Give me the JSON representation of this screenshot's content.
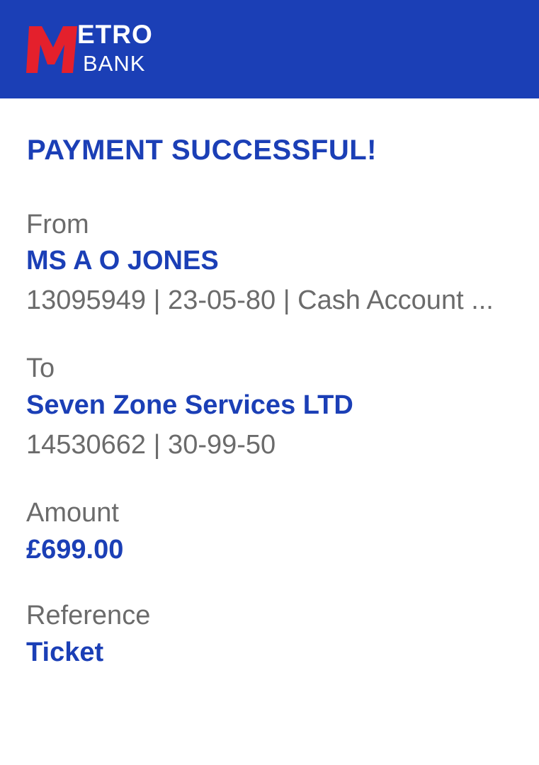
{
  "header": {
    "brand_line1": "ETRO",
    "brand_line2": "BANK",
    "brand_color": "#1b3fb6",
    "logo_accent_color": "#e4202c"
  },
  "confirmation": {
    "title": "PAYMENT SUCCESSFUL!",
    "from": {
      "label": "From",
      "name": "MS A O JONES",
      "details": "13095949 | 23-05-80 | Cash Account ..."
    },
    "to": {
      "label": "To",
      "name": "Seven Zone Services LTD",
      "details": "14530662 | 30-99-50"
    },
    "amount": {
      "label": "Amount",
      "value": "£699.00"
    },
    "reference": {
      "label": "Reference",
      "value": "Ticket"
    }
  }
}
